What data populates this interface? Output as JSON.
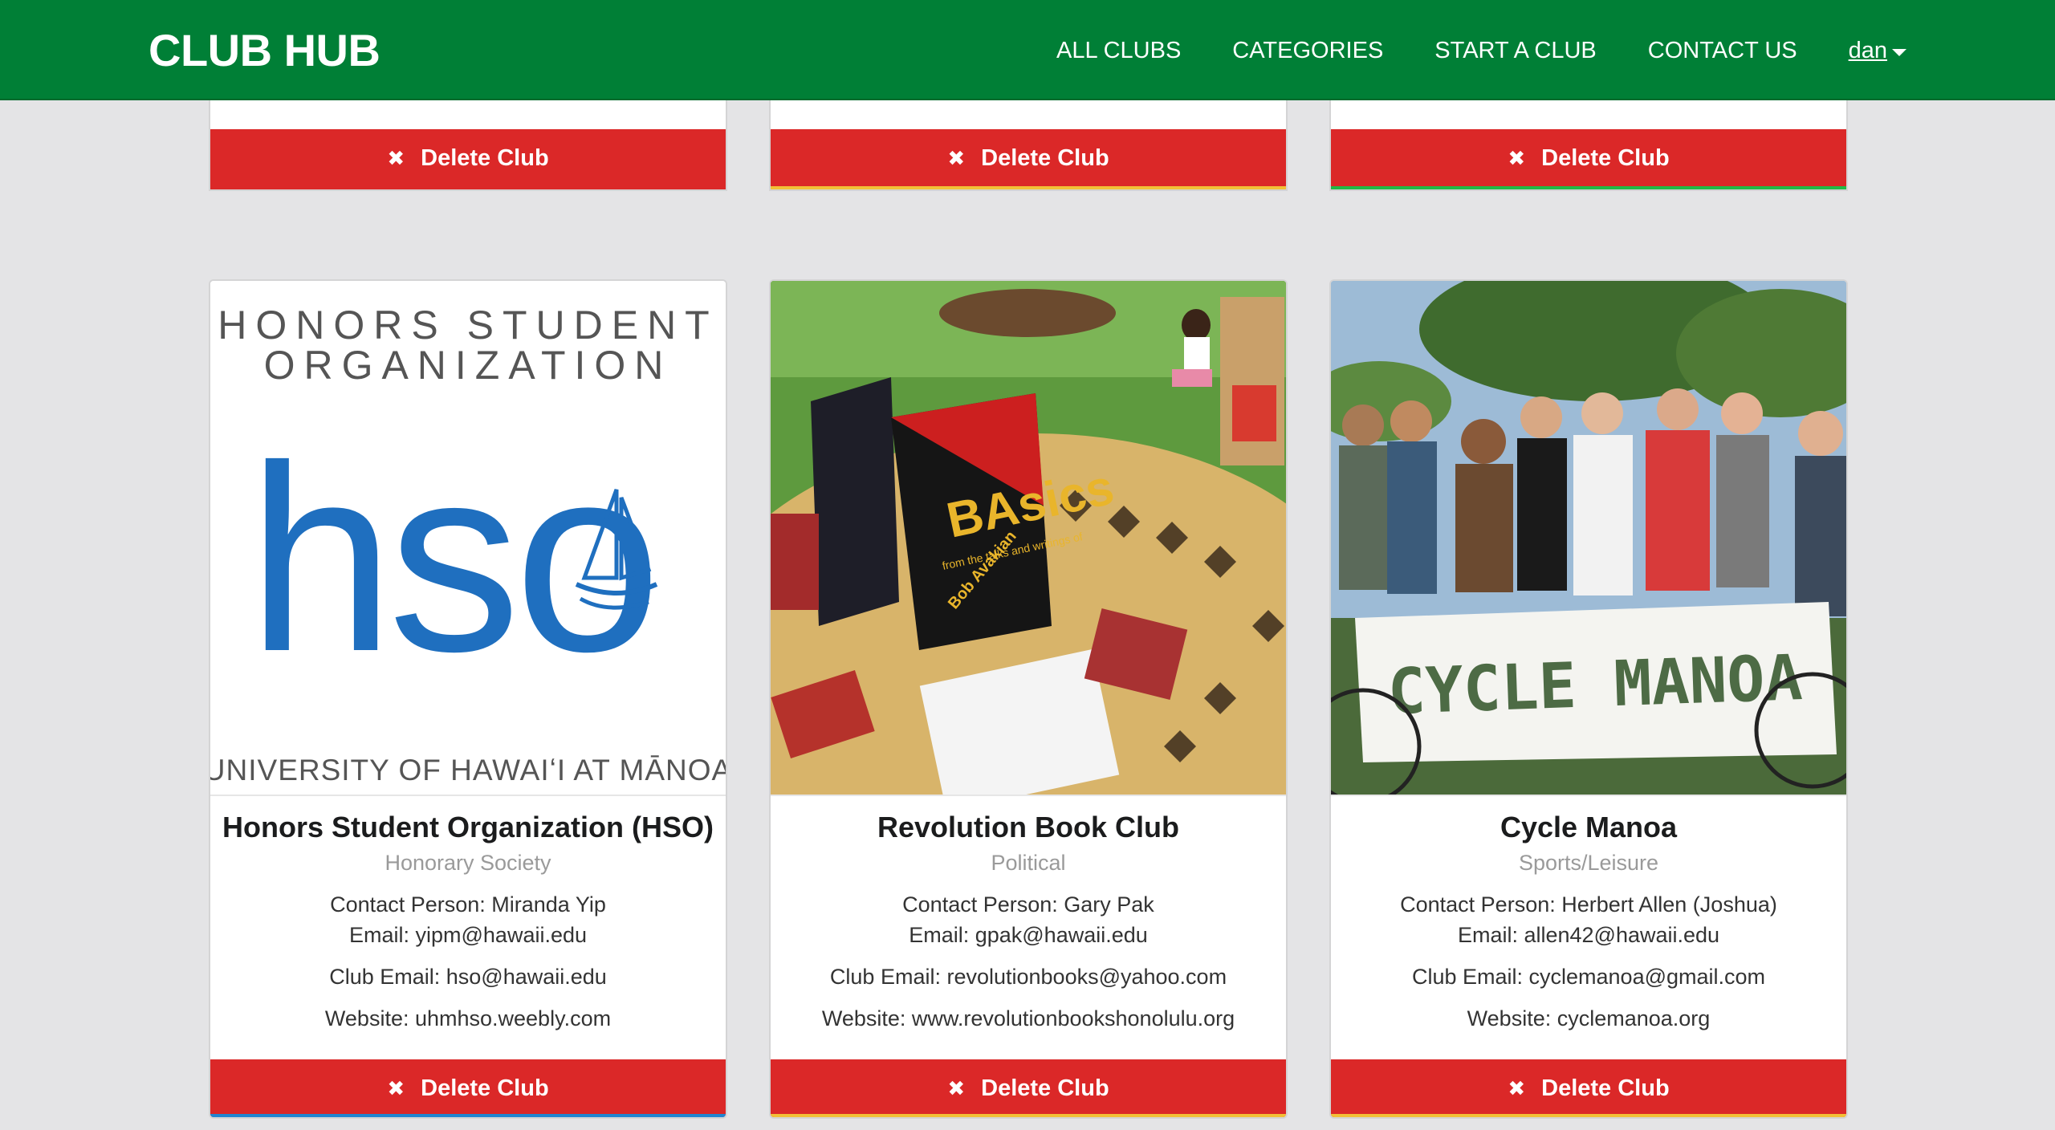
{
  "nav": {
    "brand": "CLUB HUB",
    "links": [
      "ALL CLUBS",
      "CATEGORIES",
      "START A CLUB",
      "CONTACT US"
    ],
    "user": "dan"
  },
  "top_cards": [
    {
      "delete_label": "Delete Club",
      "accent": "#db2828"
    },
    {
      "delete_label": "Delete Club",
      "accent": "#f2c037"
    },
    {
      "delete_label": "Delete Club",
      "accent": "#21ba45"
    }
  ],
  "cards": [
    {
      "title": "Honors Student Organization (HSO)",
      "category": "Honorary Society",
      "contact": "Contact Person: Miranda Yip",
      "email": "Email: yipm@hawaii.edu",
      "club_email": "Club Email: hso@hawaii.edu",
      "website": "Website: uhmhso.weebly.com",
      "delete_label": "Delete Club",
      "accent": "#2185d0",
      "logo": {
        "line1": "HONORS STUDENT",
        "line2": "ORGANIZATION",
        "mark": "hso",
        "footer": "UNIVERSITY OF HAWAIʻI AT MĀNOA",
        "color": "#1f6fbf"
      }
    },
    {
      "title": "Revolution Book Club",
      "category": "Political",
      "contact": "Contact Person: Gary Pak",
      "email": "Email: gpak@hawaii.edu",
      "club_email": "Club Email: revolutionbooks@yahoo.com",
      "website": "Website: www.revolutionbookshonolulu.org",
      "delete_label": "Delete Club",
      "accent": "#f2c037",
      "photo": {
        "book_title": "BAsics",
        "book_subtitle": "from the talks and writings of",
        "book_author": "Bob Avakian"
      }
    },
    {
      "title": "Cycle Manoa",
      "category": "Sports/Leisure",
      "contact": "Contact Person: Herbert Allen (Joshua)",
      "email": "Email: allen42@hawaii.edu",
      "club_email": "Club Email: cyclemanoa@gmail.com",
      "website": "Website: cyclemanoa.org",
      "delete_label": "Delete Club",
      "accent": "#f2c037",
      "photo": {
        "banner": "CYCLE MANOA"
      }
    }
  ],
  "colors": {
    "navbar": "#007f36",
    "delete": "#db2828",
    "background": "#e4e4e6"
  }
}
